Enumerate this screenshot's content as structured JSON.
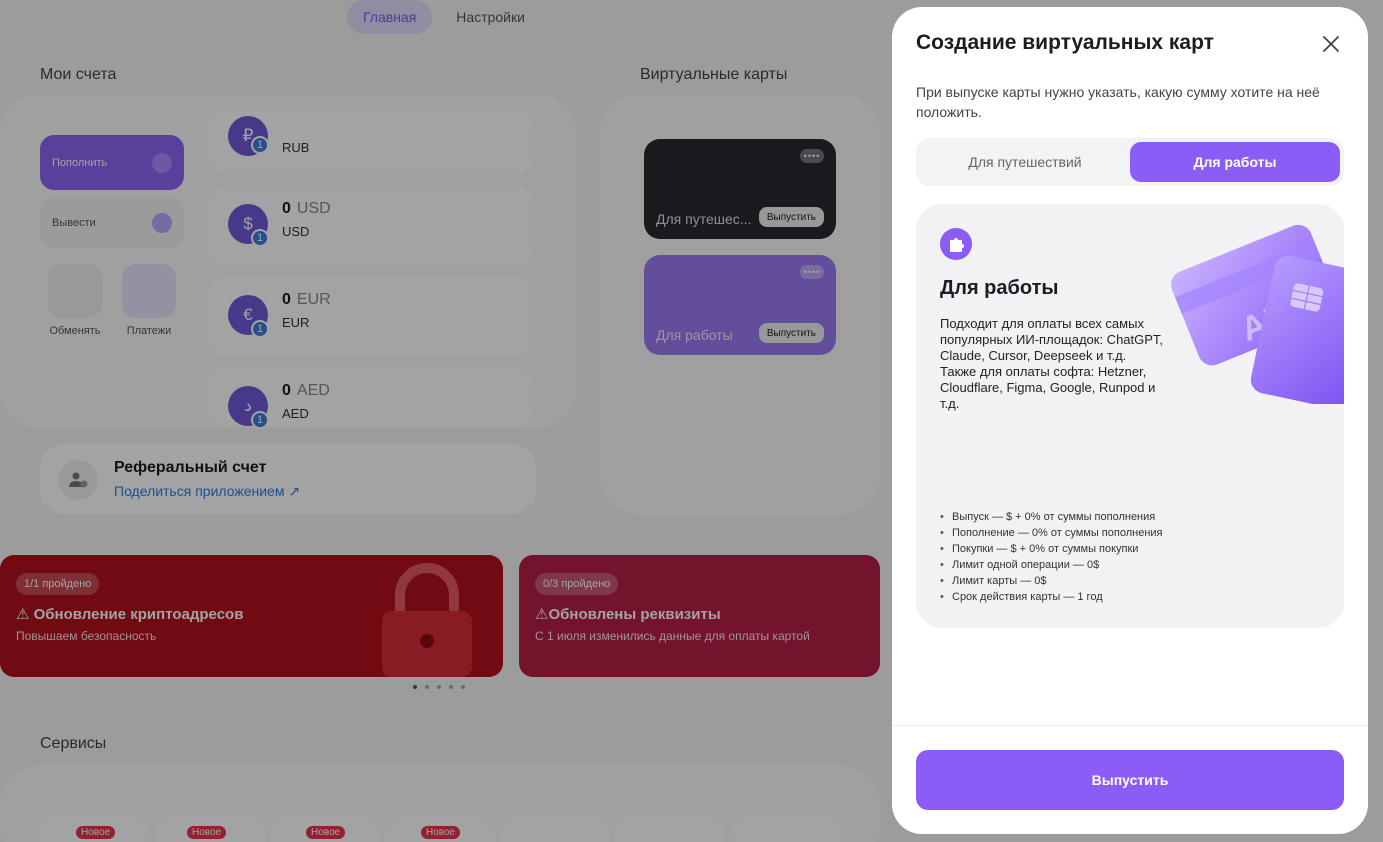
{
  "nav": {
    "tabs": [
      "Главная",
      "Настройки"
    ]
  },
  "accounts": {
    "title": "Мои счета",
    "actions": {
      "topup": "Пополнить",
      "withdraw": "Вывести",
      "exchange": "Обменять",
      "payments": "Платежи"
    },
    "list": [
      {
        "symbol": "₽",
        "badge": "1",
        "amount": "",
        "currency": "",
        "code": "RUB"
      },
      {
        "symbol": "$",
        "badge": "1",
        "amount": "0",
        "currency": "USD",
        "code": "USD"
      },
      {
        "symbol": "€",
        "badge": "1",
        "amount": "0",
        "currency": "EUR",
        "code": "EUR"
      },
      {
        "symbol": "د",
        "badge": "1",
        "amount": "0",
        "currency": "AED",
        "code": "AED"
      }
    ]
  },
  "virtual_cards": {
    "title": "Виртуальные карты",
    "cards": [
      {
        "name": "Для путешес...",
        "action": "Выпустить",
        "dots": "••••"
      },
      {
        "name": "Для работы",
        "action": "Выпустить",
        "dots": "••••"
      }
    ]
  },
  "referral": {
    "title": "Реферальный счет",
    "link": "Поделиться приложением ↗"
  },
  "banners": [
    {
      "progress": "1/1 пройдено",
      "title": "⚠ Обновление криптоадресов",
      "subtitle": "Повышаем безопасность",
      "color": "#b3101c"
    },
    {
      "progress": "0/3 пройдено",
      "title": "⚠Обновлены реквизиты",
      "subtitle": "С 1 июля изменились данные для оплаты картой",
      "color": "#b41e46"
    }
  ],
  "services": {
    "title": "Сервисы",
    "new_label": "Новое"
  },
  "modal": {
    "title": "Создание виртуальных карт",
    "description": "При выпуске карты нужно указать, какую сумму хотите на неё положить.",
    "segments": [
      "Для путешествий",
      "Для работы"
    ],
    "selected_segment": "Для работы",
    "card": {
      "heading": "Для работы",
      "text": "Подходит для оплаты всех самых популярных ИИ-площадок: ChatGPT, Claude, Cursor, Deepseek и т.д. Также для оплаты софта: Hetzner, Cloudflare, Figma, Google, Runpod и т.д.",
      "art_text": "AI",
      "features": [
        "Выпуск — $ + 0% от суммы пополнения",
        "Пополнение — 0% от суммы пополнения",
        "Покупки — $ + 0% от суммы покупки",
        "Лимит одной операции — 0$",
        "Лимит карты — 0$",
        "Срок действия карты — 1 год"
      ]
    },
    "submit": "Выпустить"
  },
  "colors": {
    "accent": "#8b5cf6",
    "link": "#2f7de0"
  }
}
